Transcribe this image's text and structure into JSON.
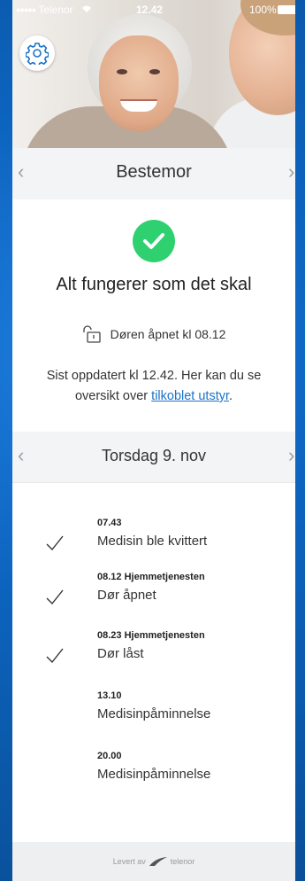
{
  "status_bar": {
    "carrier": "Telenor",
    "signal_dots": "●●●●●",
    "time": "12.42",
    "battery": "100%"
  },
  "person": {
    "name": "Bestemor"
  },
  "status": {
    "title": "Alt fungerer som det skal",
    "door_text": "Døren åpnet kl 08.12",
    "updated_text": "Sist oppdatert kl 12.42. Her kan du se oversikt over",
    "updated_link": "tilkoblet utstyr",
    "updated_end": "."
  },
  "day": {
    "label": "Torsdag 9. nov"
  },
  "events": [
    {
      "time": "07.43",
      "title": "Medisin ble kvittert",
      "checked": true
    },
    {
      "time": "08.12 Hjemmetjenesten",
      "title": "Dør åpnet",
      "checked": true
    },
    {
      "time": "08.23 Hjemmetjenesten",
      "title": "Dør låst",
      "checked": true
    },
    {
      "time": "13.10",
      "title": "Medisinpåminnelse",
      "checked": false
    },
    {
      "time": "20.00",
      "title": "Medisinpåminnelse",
      "checked": false
    }
  ],
  "footer": {
    "delivered_by": "Levert av",
    "brand": "telenor"
  },
  "icons": {
    "settings": "gear-icon",
    "status": "checkmark-icon",
    "door": "unlocked-padlock-icon",
    "prev": "chevron-left-icon",
    "next": "chevron-right-icon",
    "event_done": "check-icon",
    "brand_logo": "telenor-logo-icon"
  },
  "colors": {
    "accent_link": "#1a73c8",
    "status_green": "#2fd06f",
    "background_blue": "#0c63bd"
  }
}
